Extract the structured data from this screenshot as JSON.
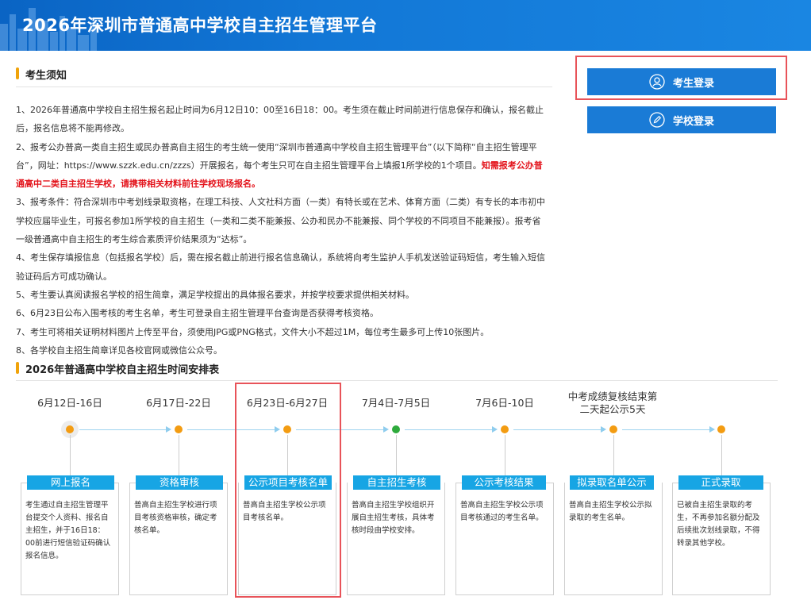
{
  "header": {
    "title": "2026年深圳市普通高中学校自主招生管理平台"
  },
  "notice": {
    "title": "考生须知",
    "items": [
      "1、2026年普通高中学校自主招生报名起止时间为6月12日10：00至16日18：00。考生须在截止时间前进行信息保存和确认，报名截止后，报名信息将不能再修改。",
      "2、报考公办普高一类自主招生或民办普高自主招生的考生统一使用“深圳市普通高中学校自主招生管理平台”（以下简称“自主招生管理平台”，网址：https://www.szzk.edu.cn/zzzs）开展报名，每个考生只可在自主招生管理平台上填报1所学校的1个项目。",
      "知需报考公办普通高中二类自主招生学校，请携带相关材料前往学校现场报名。",
      "3、报考条件：符合深圳市中考划线录取资格，在理工科技、人文社科方面（一类）有特长或在艺术、体育方面（二类）有专长的本市初中学校应届毕业生，可报名参加1所学校的自主招生（一类和二类不能兼报、公办和民办不能兼报、同个学校的不同项目不能兼报）。报考省一级普通高中自主招生的考生综合素质评价结果须为“达标”。",
      "4、考生保存填报信息（包括报名学校）后，需在报名截止前进行报名信息确认，系统将向考生监护人手机发送验证码短信，考生输入短信验证码后方可成功确认。",
      "5、考生要认真阅读报名学校的招生简章，满足学校提出的具体报名要求，并按学校要求提供相关材料。",
      "6、6月23日公布入围考核的考生名单，考生可登录自主招生管理平台查询是否获得考核资格。",
      "7、考生可将相关证明材料图片上传至平台，须使用JPG或PNG格式，文件大小不超过1M，每位考生最多可上传10张图片。",
      "8、各学校自主招生简章详见各校官网或微信公众号。"
    ]
  },
  "buttons": {
    "student_login": "考生登录",
    "school_login": "学校登录"
  },
  "schedule": {
    "title": "2026年普通高中学校自主招生时间安排表",
    "stages": [
      {
        "date": "6月12日-16日",
        "label": "网上报名",
        "text": "考生通过自主招生管理平台提交个人资料、报名自主招生，并于16日18：00前进行短信验证码确认报名信息。"
      },
      {
        "date": "6月17日-22日",
        "label": "资格审核",
        "text": "普高自主招生学校进行项目考核资格审核，确定考核名单。"
      },
      {
        "date": "6月23日-6月27日",
        "label": "公示项目考核名单",
        "text": "普高自主招生学校公示项目考核名单。"
      },
      {
        "date": "7月4日-7月5日",
        "label": "自主招生考核",
        "text": "普高自主招生学校组织开展自主招生考核，具体考核时段由学校安排。"
      },
      {
        "date": "7月6日-10日",
        "label": "公示考核结果",
        "text": "普高自主招生学校公示项目考核通过的考生名单。"
      },
      {
        "date": "中考成绩复核结束第二天起公示5天",
        "label": "拟录取名单公示",
        "text": "普高自主招生学校公示拟录取的考生名单。"
      },
      {
        "date": "",
        "label": "正式录取",
        "text": "已被自主招生录取的考生，不再参加名额分配及后续批次划线录取，不得转录其他学校。"
      }
    ]
  },
  "colors": {
    "header": "#1277d6",
    "button": "#1a7bd6",
    "label": "#17a5e4",
    "accent": "#f0a30a",
    "highlight": "#e85359",
    "red_text": "#e3131b"
  }
}
